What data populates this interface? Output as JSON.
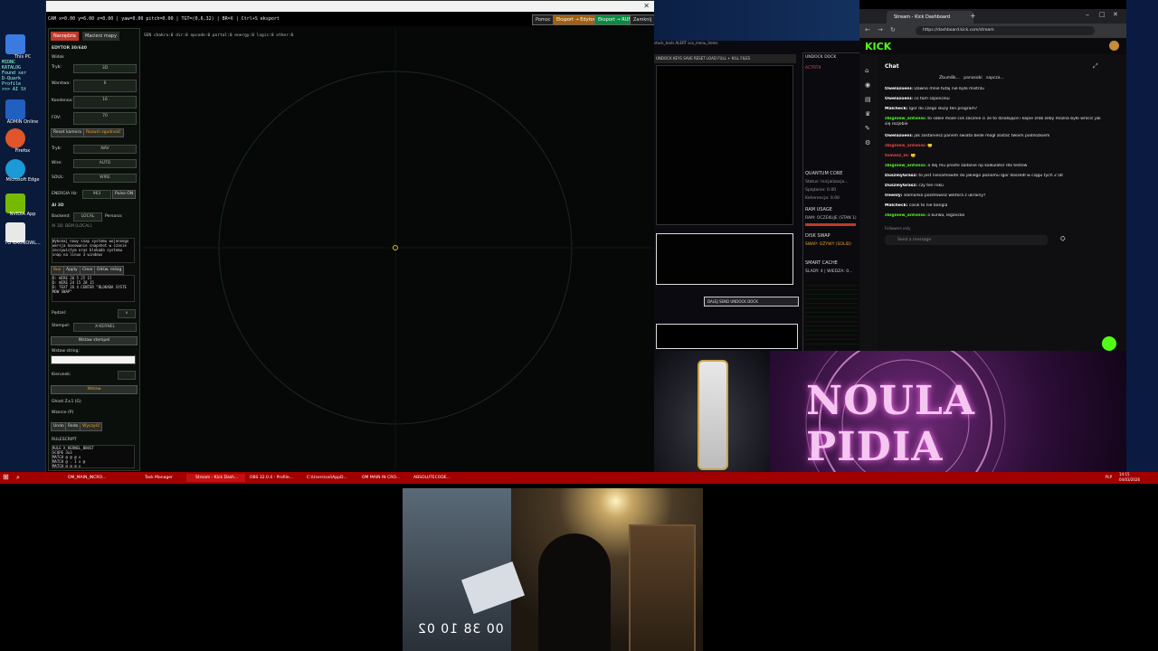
{
  "desktop": {
    "icons": [
      {
        "label": "This PC"
      },
      {
        "label": "ADMIN Online"
      },
      {
        "label": "Firefox"
      },
      {
        "label": "Microsoft Edge"
      },
      {
        "label": "NVIDIA App"
      },
      {
        "label": "TO NAUNOWL..."
      }
    ],
    "console_lines": [
      "MIDNC",
      "KATALOG",
      "Found ser",
      "D-Quark",
      "Profile",
      ">>> AI St"
    ]
  },
  "editor": {
    "hud_text": "CAM x=0.00 y=6.00 z=0.00 | yaw=0.00 pitch=0.00 | TGT=(0,6,32) | BR=X | Ctrl+S eksport",
    "header_buttons": [
      "Pomoc",
      "Eksport → Edytor",
      "Eksport → RUN",
      "Zamknij"
    ],
    "filter_line": "SEN chakra:0 dir:0 opcode:0 portal:0 energy:0 logic:0 other:0",
    "tabs": [
      "Narzędzia",
      "Macierz mapy"
    ],
    "panel_title": "EDYTOR 30/640",
    "section_label": "Widok",
    "mode_label": "Tryb:",
    "mode_value": "3D",
    "slider_labels": [
      "Warstwa:",
      "Kondensa:",
      "FOV:"
    ],
    "slider_values": [
      "6",
      "16",
      "70"
    ],
    "reset_camera": "Reset kamera",
    "rozwin": "Rozwiń zgodność",
    "tryb_label": "Tryb:",
    "tryb_value": "NAV",
    "wire_label": "Wire:",
    "wire_value": "AUTO",
    "soul_label": "SOUL:",
    "soul_value": "WIRE",
    "energia_label": "ENERGIA Hz:",
    "energia_value": "963",
    "pulse_label": "Pulse ON",
    "ai_label": "AI 3D",
    "ai_backend_label": "Backend:",
    "ai_backend_value": "LOCAL",
    "ai_persona_label": "Persona:",
    "ai_hint": "AI 3D: BEM [LOCAL]",
    "ai_body": "Wykonaj nowy snap systemu wojennego\nwersja kasowanie snapshot w czasie\nzeczywistym oraz blokada systemu\nsnap na linux 3 windows",
    "ai_buttons": [
      "Run",
      "Apply",
      "Clear",
      "Odśw. mózg"
    ],
    "ai_output": "D: WIRE 20 5 25 15\nD: WIRE 24 15 28 15\nD: TEXT 26 4 CENTER \"BLOKADA SYSTE\nMOW SNAP\"",
    "pedzel_label": "Pędzel:",
    "pedzel_value": "x",
    "stempel_label": "Stempel:",
    "stempel_value": "X-KERNEL",
    "insert_stamp": "Wstaw stempel",
    "insert_string_label": "Wstaw string:",
    "kierunek_label": "Kierunek:",
    "insert_btn": "Wstaw",
    "ghost_label": "Ghost Z±1 (G)",
    "wzorce_label": "Wzorce (P)",
    "undo_buttons": [
      "Undo",
      "Redo",
      "Wyczyść"
    ],
    "rules_label": "RULESCRIPT",
    "rules_code": "RULE X_KERNEL_BOOST\nSCOPE 3x3\nMATCH @ @ @ x\nMATCH @ . 1 x @\nMATCH @ @ @ x"
  },
  "middle_windows": {
    "tabs_line": "stock_tools  ALERT  sco_menu_items",
    "toolbar": "UNDOCK  KEYS  SAVE  RESET  LOAD FULL  + KILL FILES",
    "panel_title": "UNDOCK  DOCK",
    "panel_sub": "ACTRTX",
    "quantum": {
      "title": "QUANTUM CORE",
      "status": "Status: Inicjalizacja...",
      "spl": "Splątanie: 0.00",
      "koh": "Koherencja: 0.00"
    },
    "ram": {
      "title": "RAM USAGE",
      "line": "RAM: OCZEKUJE (STAN 1)"
    },
    "disk": {
      "title": "DISK SWAP",
      "line": "SWAP: OŻYWY (SOLID)"
    },
    "cache": {
      "title": "SMART CACHE",
      "line": "ŚLADY: 4 | WIEDZA: 0..."
    },
    "dock_buttons": "DALEJ  SEND  UNDOCK  DOCK"
  },
  "browser": {
    "tab_title": "Stream - Kick Dashboard",
    "url": "https://dashboard.kick.com/stream",
    "logo": "KICK",
    "chat_title": "Chat",
    "mentions": [
      "Zbum8k...",
      "panasobi",
      "sapcza..."
    ],
    "messages": [
      {
        "user": "Owelazoeni:",
        "text": "Dawno mnie tutaj nie było mistrzu"
      },
      {
        "user": "Owelazoeni:",
        "text": "co tam szponciku"
      },
      {
        "user": "Malcheck:",
        "text": "Igor do czego służy ten program?"
      },
      {
        "user": "zbigniew_antonio:",
        "text": "to sobie może coś zacznie ci ze to działające i kopie zrób żeby można było wrócić jak się rozjebie"
      },
      {
        "user": "Owelazoeni:",
        "text": "jak zostaniesz panem świata bede mógł zostać twoim podnóżkiem"
      },
      {
        "user": "zbigniew_antonio:",
        "text": "🙂"
      },
      {
        "user": "tomasz_m:",
        "text": "🙂"
      },
      {
        "user": "zbigniew_antonio:",
        "text": "a daj mu proste zadanie np kalkulator dla testów"
      },
      {
        "user": "DuszmyGrasz:",
        "text": "to jest niesamowite do jakiego poziomu Igor doszedł w ciągu tych 2 lat"
      },
      {
        "user": "DuszmyGrasz:",
        "text": "czy ten roku"
      },
      {
        "user": "Ireenly:",
        "text": "słamanko pozdrowisz wiktora z ukrainy?"
      },
      {
        "user": "Malcheck:",
        "text": "cosik to nie bangla"
      },
      {
        "user": "zbigniew_antonio:",
        "text": "o kurwa, legancko"
      }
    ],
    "followers_only": "Followers only",
    "send_placeholder": "Send a message"
  },
  "banner": {
    "text": "NOULA PIDIA"
  },
  "taskbar": {
    "items": [
      "OM_MAIN_INCRO...",
      "Task Manager",
      "Stream - Kick Dash...",
      "OBS 32.0.4 - Profile...",
      "C:\\Users\\sol\\AppD...",
      "OM MAIN IN CRO...",
      "ABSOLUTECODE..."
    ],
    "clock_time": "14:15",
    "clock_date": "04/03/2026",
    "lang": "PLP"
  },
  "webcam": {
    "timecode": "00 38 10 02"
  },
  "colors": {
    "accent": "#c44",
    "kick_green": "#53fc18",
    "taskbar": "#a10000"
  }
}
